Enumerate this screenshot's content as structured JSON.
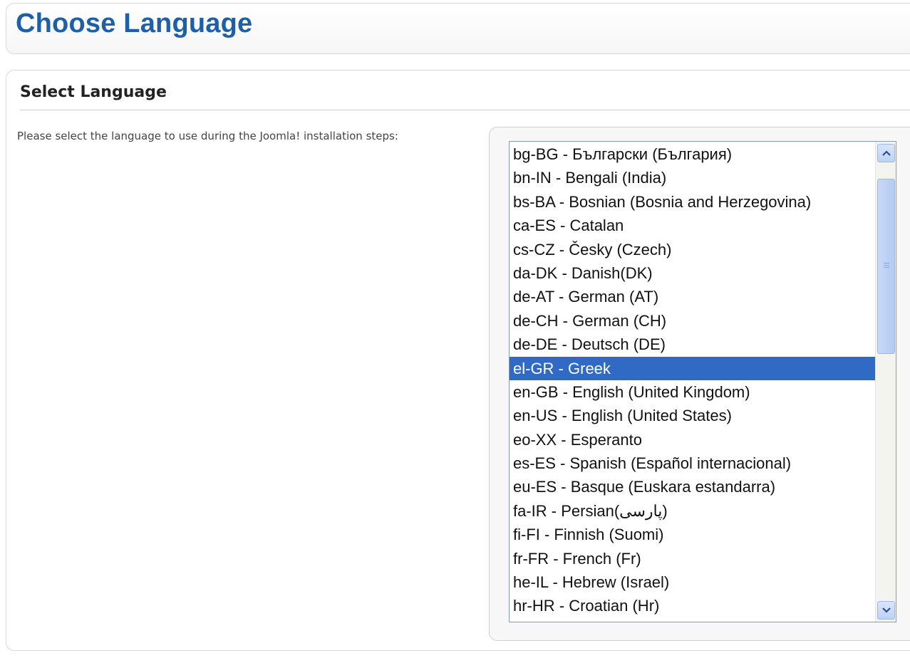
{
  "header": {
    "title": "Choose Language"
  },
  "section": {
    "title": "Select Language",
    "instructions": "Please select the language to use during the Joomla! installation steps:"
  },
  "language_select": {
    "selected": "el-GR - Greek",
    "options": [
      "bg-BG - Български (България)",
      "bn-IN - Bengali (India)",
      "bs-BA - Bosnian (Bosnia and Herzegovina)",
      "ca-ES - Catalan",
      "cs-CZ - Česky (Czech)",
      "da-DK - Danish(DK)",
      "de-AT - German (AT)",
      "de-CH - German (CH)",
      "de-DE - Deutsch (DE)",
      "el-GR - Greek",
      "en-GB - English (United Kingdom)",
      "en-US - English (United States)",
      "eo-XX - Esperanto",
      "es-ES - Spanish (Español internacional)",
      "eu-ES - Basque (Euskara estandarra)",
      "fa-IR - Persian(پارسی)",
      "fi-FI - Finnish (Suomi)",
      "fr-FR - French (Fr)",
      "he-IL - Hebrew (Israel)",
      "hr-HR - Croatian (Hr)"
    ]
  },
  "colors": {
    "title": "#1d5fa8",
    "selection": "#316ac5"
  },
  "icons": {
    "scroll_up": "chevron-up-icon",
    "scroll_down": "chevron-down-icon"
  }
}
